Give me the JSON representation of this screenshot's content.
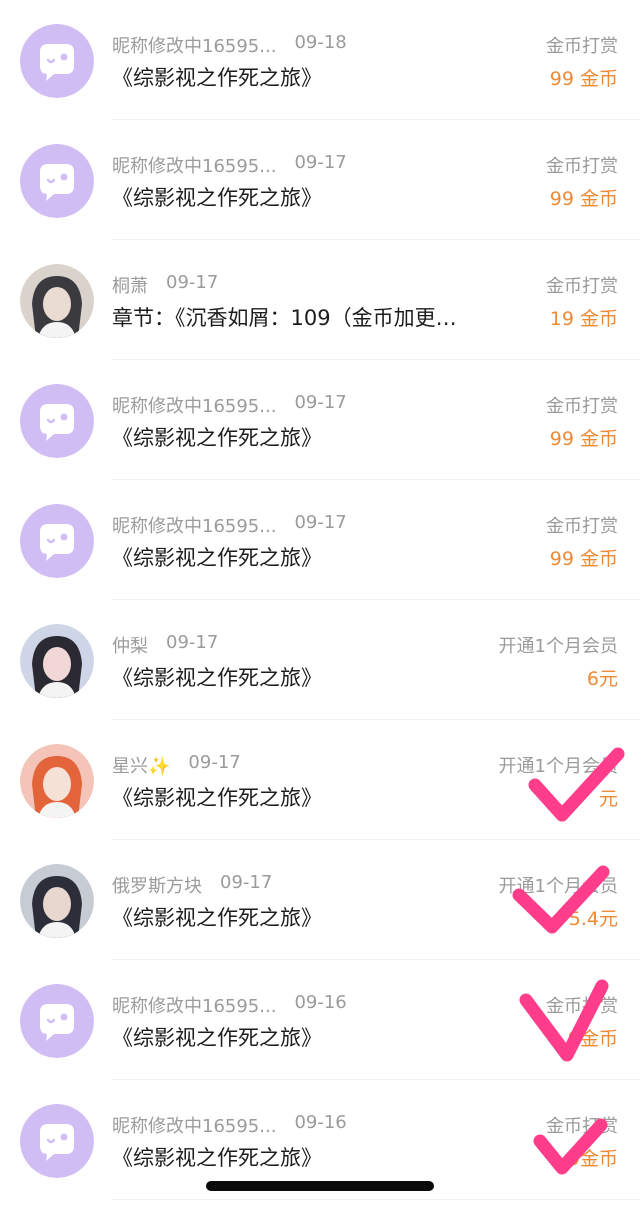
{
  "items": [
    {
      "name": "昵称修改中16595...",
      "date": "09-18",
      "title": "《综影视之作死之旅》",
      "type": "金币打赏",
      "amount": "99 金币",
      "avatar": "default-chat-bubble-avatar"
    },
    {
      "name": "昵称修改中16595...",
      "date": "09-17",
      "title": "《综影视之作死之旅》",
      "type": "金币打赏",
      "amount": "99 金币",
      "avatar": "default-chat-bubble-avatar"
    },
    {
      "name": "桐萧",
      "date": "09-17",
      "title": "章节：《沉香如屑：109（金币加更…",
      "type": "金币打赏",
      "amount": "19 金币",
      "avatar": "user-photo-avatar"
    },
    {
      "name": "昵称修改中16595...",
      "date": "09-17",
      "title": "《综影视之作死之旅》",
      "type": "金币打赏",
      "amount": "99 金币",
      "avatar": "default-chat-bubble-avatar"
    },
    {
      "name": "昵称修改中16595...",
      "date": "09-17",
      "title": "《综影视之作死之旅》",
      "type": "金币打赏",
      "amount": "99 金币",
      "avatar": "default-chat-bubble-avatar"
    },
    {
      "name": "仲梨",
      "date": "09-17",
      "title": "《综影视之作死之旅》",
      "type": "开通1个月会员",
      "amount": "6元",
      "avatar": "user-photo-avatar"
    },
    {
      "name": "星兴✨",
      "date": "09-17",
      "title": "《综影视之作死之旅》",
      "type": "开通1个月会员",
      "amount": "元",
      "avatar": "user-photo-avatar"
    },
    {
      "name": "俄罗斯方块",
      "date": "09-17",
      "title": "《综影视之作死之旅》",
      "type": "开通1个月会员",
      "amount": "5.4元",
      "avatar": "user-photo-avatar"
    },
    {
      "name": "昵称修改中16595...",
      "date": "09-16",
      "title": "《综影视之作死之旅》",
      "type": "金币打赏",
      "amount": "9金币",
      "avatar": "default-chat-bubble-avatar"
    },
    {
      "name": "昵称修改中16595...",
      "date": "09-16",
      "title": "《综影视之作死之旅》",
      "type": "金币打赏",
      "amount": "9金币",
      "avatar": "default-chat-bubble-avatar"
    }
  ],
  "colors": {
    "accent_amount": "#ef8a34",
    "muted_text": "#9b9b9b",
    "avatar_default_bg": "#cfbdf4",
    "checkmark": "#ff3d8b"
  }
}
